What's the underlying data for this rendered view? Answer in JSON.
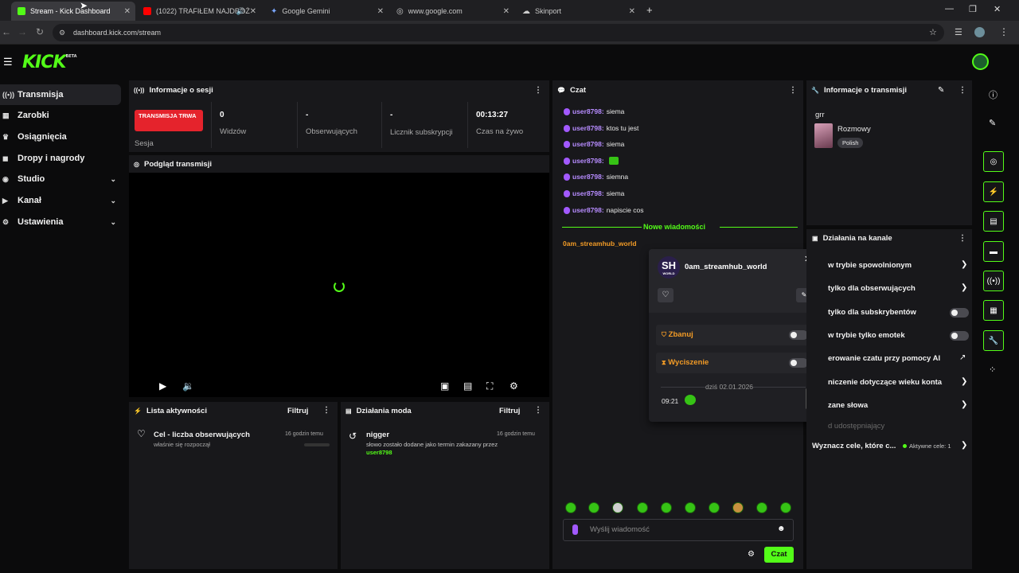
{
  "browser": {
    "tabs": [
      {
        "title": "Stream - Kick Dashboard",
        "fav": "#53fc18"
      },
      {
        "title": "(1022) TRAFIŁEM NAJDROŻ",
        "fav": "#ff0000"
      },
      {
        "title": "Google Gemini",
        "fav": "#7aa7ff"
      },
      {
        "title": "www.google.com",
        "fav": "#cccccc"
      },
      {
        "title": "Skinport",
        "fav": "#cccccc"
      }
    ],
    "url": "dashboard.kick.com/stream"
  },
  "app": {
    "logo": "KICK",
    "logo_tag": "BETA",
    "sidebar": [
      {
        "label": "Transmisja",
        "icon": "broadcast-icon"
      },
      {
        "label": "Zarobki",
        "icon": "chart-icon"
      },
      {
        "label": "Osiągnięcia",
        "icon": "trophy-icon"
      },
      {
        "label": "Dropy i nagrody",
        "icon": "gift-icon"
      },
      {
        "label": "Studio",
        "icon": "studio-icon"
      },
      {
        "label": "Kanał",
        "icon": "channel-icon"
      },
      {
        "label": "Ustawienia",
        "icon": "gear-icon"
      }
    ]
  },
  "session": {
    "title": "Informacje o sesji",
    "live_badge": "TRANSMISJA TRWA",
    "session_label": "Sesja",
    "viewers_value": "0",
    "viewers_label": "Widzów",
    "followers_value": "-",
    "followers_label": "Obserwujących",
    "subs_value": "-",
    "subs_label": "Licznik subskrypcji",
    "time_value": "00:13:27",
    "time_label": "Czas na żywo"
  },
  "preview": {
    "title": "Podgląd transmisji"
  },
  "activity": {
    "title": "Lista aktywności",
    "filter": "Filtruj",
    "item_title": "Cel - liczba obserwujących",
    "item_sub": "właśnie się rozpoczął",
    "item_time": "16 godzin temu"
  },
  "modactions": {
    "title": "Działania moda",
    "filter": "Filtruj",
    "item_title": "nigger",
    "item_sub": "słowo zostało dodane jako termin zakazany przez",
    "item_user": "user8798",
    "item_time": "16 godzin temu"
  },
  "chat": {
    "title": "Czat",
    "messages": [
      {
        "user": "user8798:",
        "text": "siema"
      },
      {
        "user": "user8798:",
        "text": "ktos tu jest"
      },
      {
        "user": "user8798:",
        "text": "siema"
      },
      {
        "user": "user8798:",
        "text": ""
      },
      {
        "user": "user8798:",
        "text": "siemna"
      },
      {
        "user": "user8798:",
        "text": "siema"
      },
      {
        "user": "user8798:",
        "text": "napiscie cos"
      }
    ],
    "new_messages": "Nowe wiadomości",
    "bot_user": "0am_streamhub_world",
    "input_placeholder": "Wyślij wiadomość",
    "send_label": "Czat"
  },
  "usercard": {
    "avatar_text": "SH",
    "avatar_sub": "WORLD",
    "name": "0am_streamhub_world",
    "ban_label": "Zbanuj",
    "mute_label": "Wyciszenie",
    "date_label": "dziś 02.01.2026",
    "time": "09:21"
  },
  "streaminfo": {
    "title": "Informacje o transmisji",
    "stream_title": "grr",
    "category": "Rozmowy",
    "language": "Polish"
  },
  "channelactions": {
    "title": "Działania na kanale",
    "rows": [
      {
        "label": "w trybie spowolnionym",
        "type": "chevron"
      },
      {
        "label": "tylko dla obserwujących",
        "type": "chevron"
      },
      {
        "label": "tylko dla subskrybentów",
        "type": "toggle"
      },
      {
        "label": "w trybie tylko emotek",
        "type": "toggle"
      },
      {
        "label": "erowanie czatu przy pomocy AI",
        "type": "chart"
      },
      {
        "label": "niczenie dotyczące wieku konta",
        "type": "chevron"
      },
      {
        "label": "zane słowa",
        "type": "chevron"
      },
      {
        "label": "d udostępniający",
        "type": "none"
      }
    ],
    "goal_label": "Wyznacz cele, które c...",
    "goal_active": "Aktywne cele: 1"
  },
  "colors": {
    "accent": "#53fc18",
    "live": "#e5232c",
    "username": "#b78cff"
  }
}
